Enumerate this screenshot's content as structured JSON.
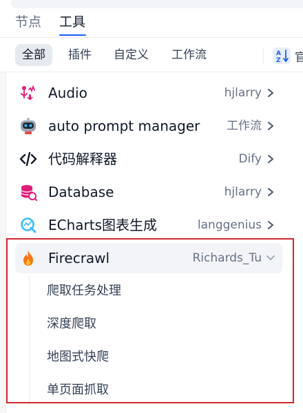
{
  "tabs": [
    {
      "label": "节点"
    },
    {
      "label": "工具"
    }
  ],
  "filters": [
    {
      "label": "全部"
    },
    {
      "label": "插件"
    },
    {
      "label": "自定义"
    },
    {
      "label": "工作流"
    }
  ],
  "sort": {
    "truncated_label": "官"
  },
  "tools": [
    {
      "name": "Audio",
      "author": "hjlarry",
      "icon": "audio-mic-icon"
    },
    {
      "name": "auto prompt manager",
      "author": "工作流",
      "icon": "robot-icon"
    },
    {
      "name": "代码解释器",
      "author": "Dify",
      "icon": "code-icon"
    },
    {
      "name": "Database",
      "author": "hjlarry",
      "icon": "database-icon"
    },
    {
      "name": "ECharts图表生成",
      "author": "langgenius",
      "icon": "echarts-icon"
    },
    {
      "name": "Firecrawl",
      "author": "Richards_Tu",
      "icon": "flame-icon",
      "expanded": true
    }
  ],
  "firecrawl_actions": [
    {
      "label": "爬取任务处理"
    },
    {
      "label": "深度爬取"
    },
    {
      "label": "地图式快爬"
    },
    {
      "label": "单页面抓取"
    }
  ],
  "colors": {
    "accent": "#155eef",
    "highlight_border": "#d0252e",
    "flame": "#f97316"
  }
}
